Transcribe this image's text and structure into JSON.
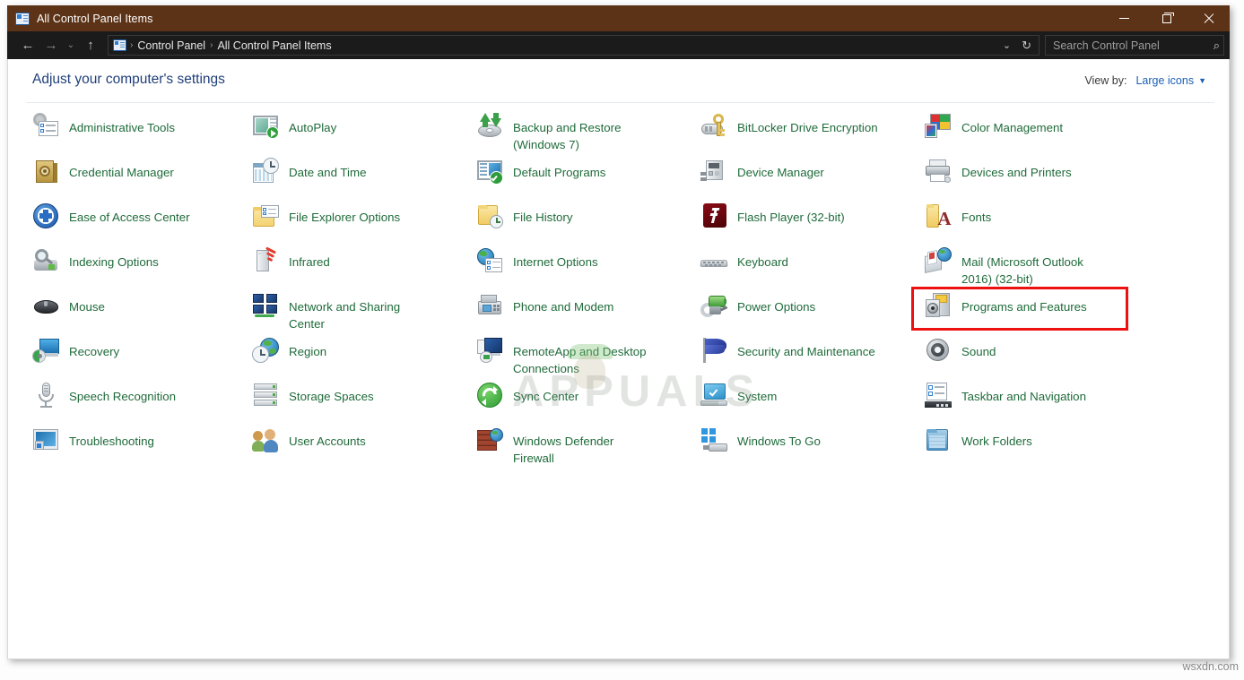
{
  "window": {
    "title": "All Control Panel Items",
    "title_icon": "control-panel-icon",
    "minimize_label": "Minimize",
    "maximize_label": "Maximize",
    "close_label": "Close"
  },
  "addressbar": {
    "back_glyph": "←",
    "forward_glyph": "→",
    "recent_glyph": "⌄",
    "up_glyph": "↑",
    "breadcrumbs": [
      "Control Panel",
      "All Control Panel Items"
    ],
    "separator": "›",
    "dropdown_glyph": "⌄",
    "refresh_glyph": "↻"
  },
  "search": {
    "placeholder": "Search Control Panel",
    "value": "",
    "icon_glyph": "⌕"
  },
  "header": {
    "title": "Adjust your computer's settings",
    "view_by_label": "View by:",
    "view_by_value": "Large icons",
    "caret_glyph": "▼"
  },
  "highlight": {
    "target": "Programs and Features",
    "color": "#ee1111"
  },
  "watermarks": {
    "center": "APPUALS",
    "corner": "wsxdn.com"
  },
  "colors": {
    "titlebar": "#5c3317",
    "addressbar": "#1b1b1b",
    "link": "#1f6b3a",
    "header_title": "#1f3f7a",
    "accent_blue": "#1a5fb4"
  },
  "items": [
    {
      "label": "Administrative Tools",
      "icon": "administrative-tools-icon",
      "col": 0,
      "row": 0
    },
    {
      "label": "Credential Manager",
      "icon": "credential-manager-icon",
      "col": 0,
      "row": 1
    },
    {
      "label": "Ease of Access Center",
      "icon": "ease-of-access-icon",
      "col": 0,
      "row": 2
    },
    {
      "label": "Indexing Options",
      "icon": "indexing-options-icon",
      "col": 0,
      "row": 3
    },
    {
      "label": "Mouse",
      "icon": "mouse-icon",
      "col": 0,
      "row": 4
    },
    {
      "label": "Recovery",
      "icon": "recovery-icon",
      "col": 0,
      "row": 5
    },
    {
      "label": "Speech Recognition",
      "icon": "microphone-icon",
      "col": 0,
      "row": 6
    },
    {
      "label": "Troubleshooting",
      "icon": "troubleshooting-icon",
      "col": 0,
      "row": 7
    },
    {
      "label": "AutoPlay",
      "icon": "autoplay-icon",
      "col": 1,
      "row": 0
    },
    {
      "label": "Date and Time",
      "icon": "date-and-time-icon",
      "col": 1,
      "row": 1
    },
    {
      "label": "File Explorer Options",
      "icon": "file-explorer-options-icon",
      "col": 1,
      "row": 2
    },
    {
      "label": "Infrared",
      "icon": "infrared-icon",
      "col": 1,
      "row": 3
    },
    {
      "label": "Network and Sharing\nCenter",
      "icon": "network-sharing-icon",
      "col": 1,
      "row": 4
    },
    {
      "label": "Region",
      "icon": "region-icon",
      "col": 1,
      "row": 5
    },
    {
      "label": "Storage Spaces",
      "icon": "storage-spaces-icon",
      "col": 1,
      "row": 6
    },
    {
      "label": "User Accounts",
      "icon": "user-accounts-icon",
      "col": 1,
      "row": 7
    },
    {
      "label": "Backup and Restore\n(Windows 7)",
      "icon": "backup-restore-icon",
      "col": 2,
      "row": 0
    },
    {
      "label": "Default Programs",
      "icon": "default-programs-icon",
      "col": 2,
      "row": 1
    },
    {
      "label": "File History",
      "icon": "file-history-icon",
      "col": 2,
      "row": 2
    },
    {
      "label": "Internet Options",
      "icon": "internet-options-icon",
      "col": 2,
      "row": 3
    },
    {
      "label": "Phone and Modem",
      "icon": "phone-modem-icon",
      "col": 2,
      "row": 4
    },
    {
      "label": "RemoteApp and Desktop\nConnections",
      "icon": "remoteapp-icon",
      "col": 2,
      "row": 5
    },
    {
      "label": "Sync Center",
      "icon": "sync-center-icon",
      "col": 2,
      "row": 6
    },
    {
      "label": "Windows Defender\nFirewall",
      "icon": "firewall-icon",
      "col": 2,
      "row": 7
    },
    {
      "label": "BitLocker Drive Encryption",
      "icon": "bitlocker-icon",
      "col": 3,
      "row": 0
    },
    {
      "label": "Device Manager",
      "icon": "device-manager-icon",
      "col": 3,
      "row": 1
    },
    {
      "label": "Flash Player (32-bit)",
      "icon": "flash-player-icon",
      "col": 3,
      "row": 2
    },
    {
      "label": "Keyboard",
      "icon": "keyboard-icon",
      "col": 3,
      "row": 3
    },
    {
      "label": "Power Options",
      "icon": "power-options-icon",
      "col": 3,
      "row": 4
    },
    {
      "label": "Security and Maintenance",
      "icon": "security-maintenance-icon",
      "col": 3,
      "row": 5
    },
    {
      "label": "System",
      "icon": "system-icon",
      "col": 3,
      "row": 6
    },
    {
      "label": "Windows To Go",
      "icon": "windows-to-go-icon",
      "col": 3,
      "row": 7
    },
    {
      "label": "Color Management",
      "icon": "color-management-icon",
      "col": 4,
      "row": 0
    },
    {
      "label": "Devices and Printers",
      "icon": "devices-printers-icon",
      "col": 4,
      "row": 1
    },
    {
      "label": "Fonts",
      "icon": "fonts-icon",
      "col": 4,
      "row": 2
    },
    {
      "label": "Mail (Microsoft Outlook\n2016) (32-bit)",
      "icon": "mail-icon",
      "col": 4,
      "row": 3
    },
    {
      "label": "Programs and Features",
      "icon": "programs-features-icon",
      "col": 4,
      "row": 4
    },
    {
      "label": "Sound",
      "icon": "sound-icon",
      "col": 4,
      "row": 5
    },
    {
      "label": "Taskbar and Navigation",
      "icon": "taskbar-navigation-icon",
      "col": 4,
      "row": 6
    },
    {
      "label": "Work Folders",
      "icon": "work-folders-icon",
      "col": 4,
      "row": 7
    }
  ]
}
